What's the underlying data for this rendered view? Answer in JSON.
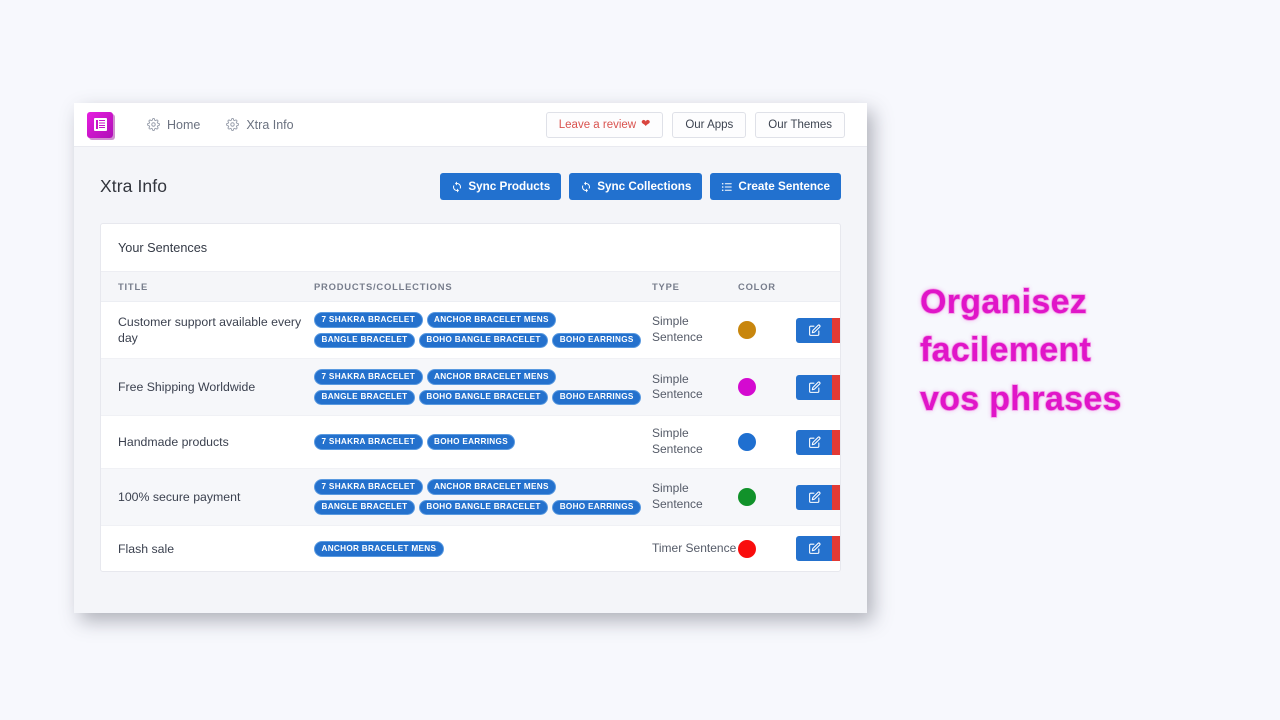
{
  "topbar": {
    "logo_icon": "list-document-icon",
    "nav": [
      {
        "label": "Home",
        "icon": "gear-icon"
      },
      {
        "label": "Xtra Info",
        "icon": "gear-icon"
      }
    ],
    "buttons": [
      {
        "label": "Leave a review",
        "icon": "heart-icon",
        "color": "#d9534f"
      },
      {
        "label": "Our Apps",
        "icon": "",
        "color": "#3d4451"
      },
      {
        "label": "Our Themes",
        "icon": "",
        "color": "#3d4451"
      }
    ]
  },
  "page": {
    "title": "Xtra Info",
    "actions": [
      {
        "label": "Sync Products",
        "icon": "sync-icon"
      },
      {
        "label": "Sync Collections",
        "icon": "sync-icon"
      },
      {
        "label": "Create Sentence",
        "icon": "list-icon"
      }
    ],
    "accent_color": "#2271cf"
  },
  "card": {
    "title": "Your Sentences",
    "columns": [
      "TITLE",
      "PRODUCTS/COLLECTIONS",
      "TYPE",
      "COLOR",
      ""
    ],
    "rows": [
      {
        "title": "Customer support available every day",
        "tags": [
          "7 SHAKRA BRACELET",
          "ANCHOR BRACELET MENS",
          "BANGLE BRACELET",
          "BOHO BANGLE BRACELET",
          "BOHO EARRINGS"
        ],
        "type": "Simple Sentence",
        "color": "#c8860d",
        "edit_label": "edit-icon",
        "delete_label": "trash-icon"
      },
      {
        "title": "Free Shipping Worldwide",
        "tags": [
          "7 SHAKRA BRACELET",
          "ANCHOR BRACELET MENS",
          "BANGLE BRACELET",
          "BOHO BANGLE BRACELET",
          "BOHO EARRINGS"
        ],
        "type": "Simple Sentence",
        "color": "#d40ad0",
        "edit_label": "edit-icon",
        "delete_label": "trash-icon"
      },
      {
        "title": "Handmade products",
        "tags": [
          "7 SHAKRA BRACELET",
          "BOHO EARRINGS"
        ],
        "type": "Simple Sentence",
        "color": "#1f6fd0",
        "edit_label": "edit-icon",
        "delete_label": "trash-icon"
      },
      {
        "title": "100% secure payment",
        "tags": [
          "7 SHAKRA BRACELET",
          "ANCHOR BRACELET MENS",
          "BANGLE BRACELET",
          "BOHO BANGLE BRACELET",
          "BOHO EARRINGS"
        ],
        "type": "Simple Sentence",
        "color": "#11922a",
        "edit_label": "edit-icon",
        "delete_label": "trash-icon"
      },
      {
        "title": "Flash sale",
        "tags": [
          "ANCHOR BRACELET MENS"
        ],
        "type": "Timer Sentence",
        "color": "#f90d0d",
        "edit_label": "edit-icon",
        "delete_label": "trash-icon"
      }
    ]
  },
  "marketing": {
    "lines": [
      "Organisez",
      "facilement",
      "vos phrases"
    ],
    "color": "#e015c8",
    "outline_color": "#f3a4e8"
  }
}
